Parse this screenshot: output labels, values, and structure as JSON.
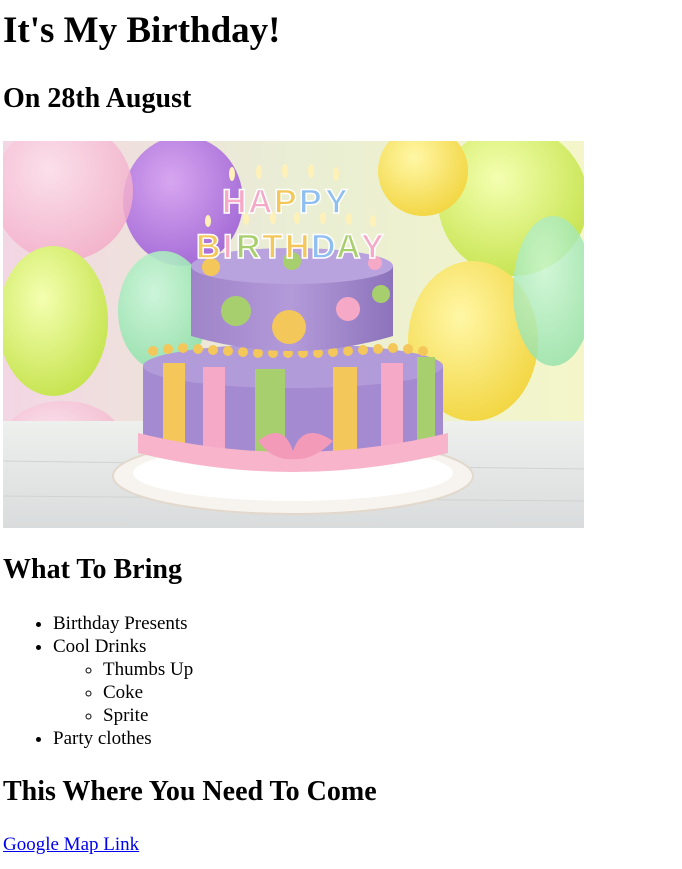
{
  "page": {
    "title": "It's My Birthday!",
    "date_heading": "On 28th August"
  },
  "image": {
    "alt": "Birthday cake",
    "candle_text_line1": "HAPPY",
    "candle_text_line2": "BIRTHDAY"
  },
  "bring": {
    "heading": "What To Bring",
    "items": [
      {
        "label": "Birthday Presents"
      },
      {
        "label": "Cool Drinks",
        "sub": [
          "Thumbs Up",
          "Coke",
          "Sprite"
        ]
      },
      {
        "label": "Party clothes"
      }
    ]
  },
  "location": {
    "heading": "This Where You Need To Come",
    "link_text": "Google Map Link"
  }
}
